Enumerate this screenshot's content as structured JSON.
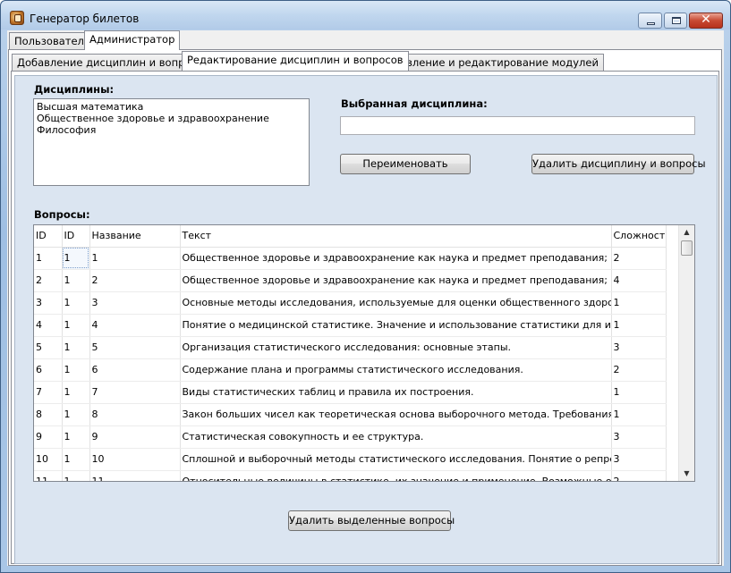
{
  "window": {
    "title": "Генератор билетов"
  },
  "main_tabs": [
    "Пользователь",
    "Администратор"
  ],
  "sub_tabs": [
    "Добавление дисциплин и вопросов",
    "Редактирование дисциплин и вопросов",
    "Добавление и редактирование модулей"
  ],
  "disciplines": {
    "label": "Дисциплины:",
    "items": [
      "Высшая математика",
      "Общественное здоровье и здравоохранение",
      "Философия"
    ]
  },
  "selected": {
    "label": "Выбранная дисциплина:",
    "value": ""
  },
  "buttons": {
    "rename": "Переименовать",
    "delete_discipline": "Удалить дисциплину и вопросы",
    "delete_selected": "Удалить выделенные вопросы"
  },
  "questions": {
    "label": "Вопросы:",
    "columns": [
      "ID",
      "ID",
      "Название",
      "Текст",
      "Сложность"
    ],
    "rows": [
      [
        "1",
        "1",
        "1",
        "Общественное здоровье и здравоохранение как наука и предмет преподавания; понятие об",
        "2"
      ],
      [
        "2",
        "1",
        "2",
        "Общественное здоровье и здравоохранение как наука и предмет преподавания; основные з",
        "4"
      ],
      [
        "3",
        "1",
        "3",
        "Основные методы исследования, используемые для оценки общественного здоровья и деяте",
        "1"
      ],
      [
        "4",
        "1",
        "4",
        "Понятие о медицинской статистике. Значение и использование статистики для изучения здо",
        "1"
      ],
      [
        "5",
        "1",
        "5",
        "Организация статистического исследования: основные этапы.",
        "3"
      ],
      [
        "6",
        "1",
        "6",
        "Содержание плана и программы статистического исследования.",
        "2"
      ],
      [
        "7",
        "1",
        "7",
        "Виды статистических таблиц и правила их построения.",
        "1"
      ],
      [
        "8",
        "1",
        "8",
        "Закон больших чисел как теоретическая основа выборочного метода. Требования к выборочн",
        "1"
      ],
      [
        "9",
        "1",
        "9",
        "Статистическая совокупность и ее структура.",
        "3"
      ],
      [
        "10",
        "1",
        "10",
        "Сплошной  и выборочный методы статистического исследования. Понятие о репрезентативн",
        "3"
      ],
      [
        "11",
        "1",
        "11",
        "Относительные величины в статистике, их значение и применение. Возможные ошибки при в",
        "2"
      ]
    ]
  }
}
